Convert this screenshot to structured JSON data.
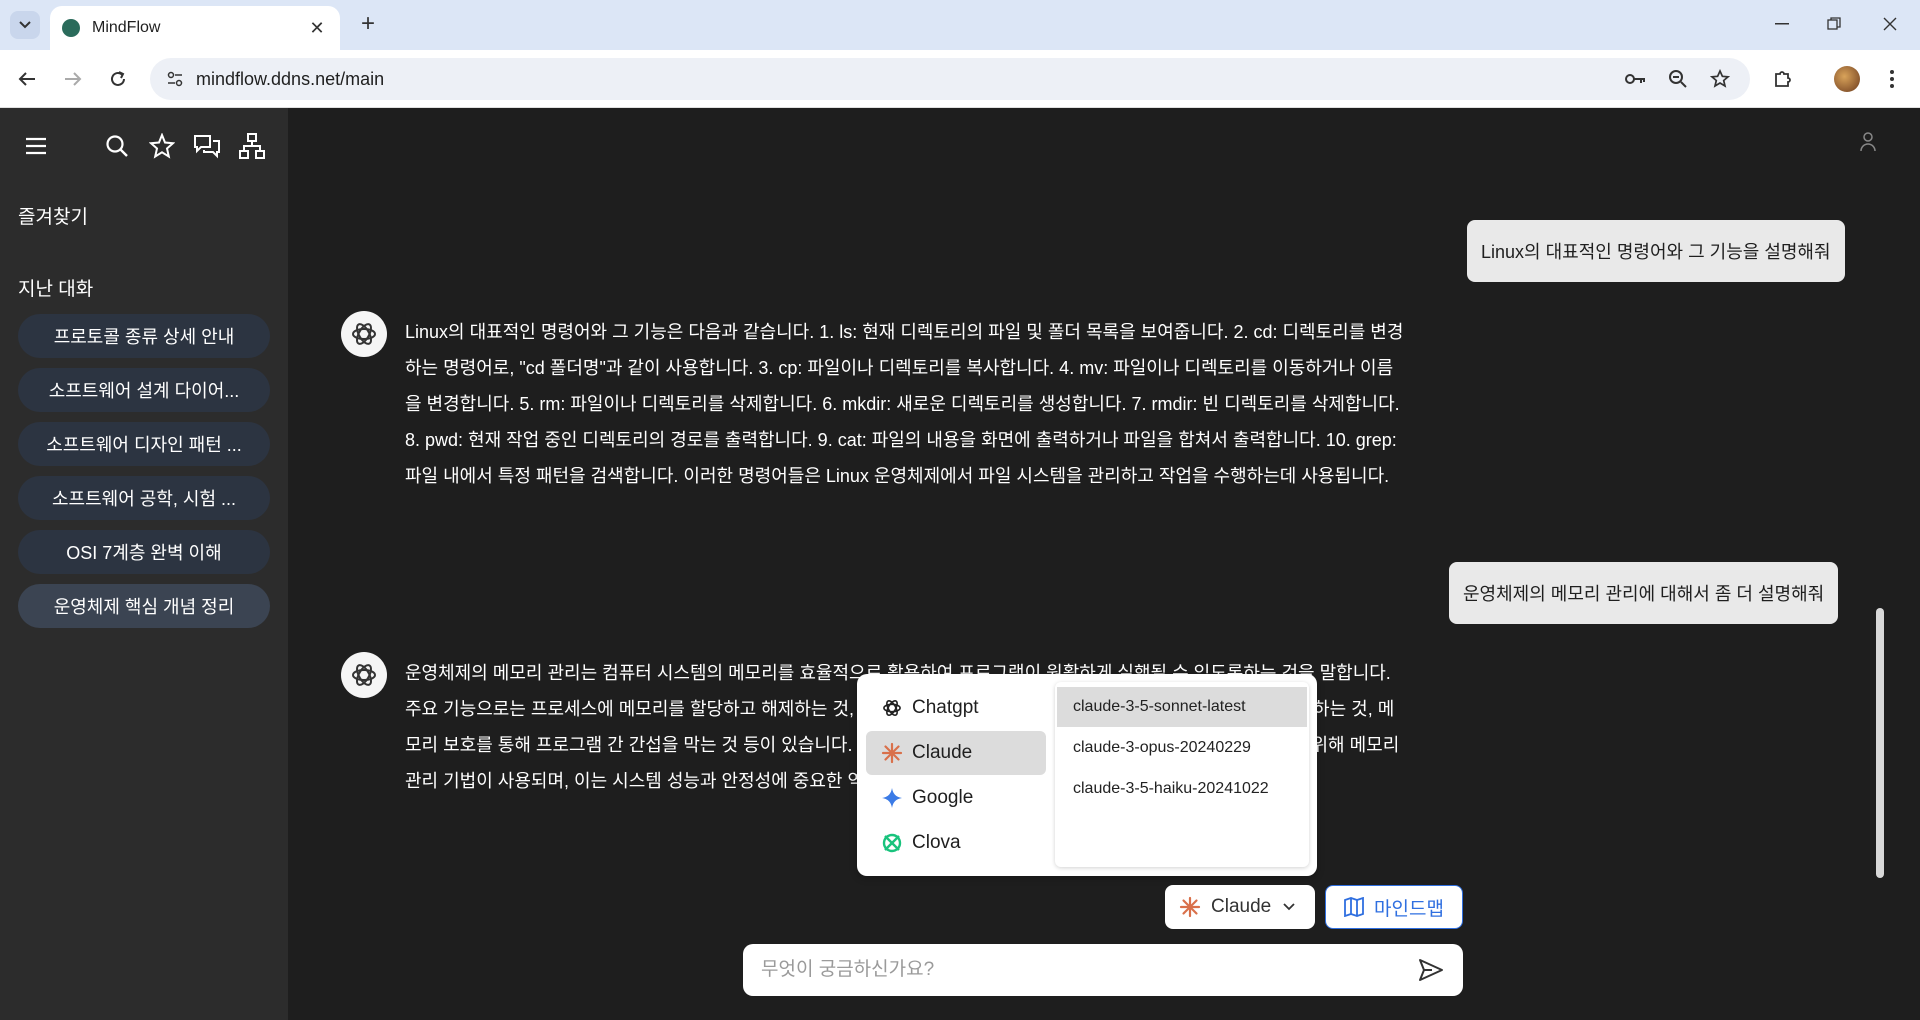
{
  "browser": {
    "tab_title": "MindFlow",
    "url": "mindflow.ddns.net/main"
  },
  "sidebar": {
    "favorites_heading": "즐겨찾기",
    "history_heading": "지난 대화",
    "history": [
      {
        "label": "프로토콜 종류 상세 안내"
      },
      {
        "label": "소프트웨어 설계 다이어..."
      },
      {
        "label": "소프트웨어 디자인 패턴 ..."
      },
      {
        "label": "소프트웨어 공학, 시험 ..."
      },
      {
        "label": "OSI 7계층 완벽 이해"
      },
      {
        "label": "운영체제 핵심 개념 정리"
      }
    ]
  },
  "chat": {
    "messages": [
      {
        "role": "user",
        "text": "Linux의 대표적인 명령어와 그 기능을 설명해줘"
      },
      {
        "role": "assistant",
        "text": "Linux의 대표적인 명령어와 그 기능은 다음과 같습니다. 1. ls: 현재 디렉토리의 파일 및 폴더 목록을 보여줍니다. 2. cd: 디렉토리를 변경하는 명령어로, \"cd 폴더명\"과 같이 사용합니다. 3. cp: 파일이나 디렉토리를 복사합니다. 4. mv: 파일이나 디렉토리를 이동하거나 이름을 변경합니다. 5. rm: 파일이나 디렉토리를 삭제합니다. 6. mkdir: 새로운 디렉토리를 생성합니다. 7. rmdir: 빈 디렉토리를 삭제합니다. 8. pwd: 현재 작업 중인 디렉토리의 경로를 출력합니다. 9. cat: 파일의 내용을 화면에 출력하거나 파일을 합쳐서 출력합니다. 10. grep: 파일 내에서 특정 패턴을 검색합니다. 이러한 명령어들은 Linux 운영체제에서 파일 시스템을 관리하고 작업을 수행하는데 사용됩니다."
      },
      {
        "role": "user",
        "text": "운영체제의 메모리 관리에 대해서 좀 더 설명해줘"
      },
      {
        "role": "assistant",
        "text": "운영체제의 메모리 관리는 컴퓨터 시스템의 메모리를 효율적으로 활용하여 프로그램이 원활하게 실행될 수 있도록하는 것을 말합니다. 주요 기능으로는 프로세스에 메모리를 할당하고 해제하는 것, 가상 메모리를 통해 물리 메모리 부족 시 보조기억장치를 사용하는 것, 메모리 보호를 통해 프로그램 간 간섭을 막는 것 등이 있습니다. 메모리 단편화를 최소화하고 효율적인 메모리 할당 및 해제를 위해 메모리 관리 기법이 사용되며, 이는 시스템 성능과 안정성에 중요한 역할을 합니다."
      }
    ]
  },
  "model_picker": {
    "providers": [
      {
        "label": "Chatgpt",
        "icon": "openai-icon"
      },
      {
        "label": "Claude",
        "icon": "claude-icon",
        "selected": true
      },
      {
        "label": "Google",
        "icon": "gemini-icon"
      },
      {
        "label": "Clova",
        "icon": "clova-icon"
      }
    ],
    "models": [
      {
        "label": "claude-3-5-sonnet-latest",
        "selected": true
      },
      {
        "label": "claude-3-opus-20240229"
      },
      {
        "label": "claude-3-5-haiku-20241022"
      }
    ]
  },
  "toolbar": {
    "model_button_label": "Claude",
    "mindmap_label": "마인드맵"
  },
  "input": {
    "placeholder": "무엇이 궁금하신가요?",
    "value": ""
  },
  "colors": {
    "accent_blue": "#2f6fe0",
    "claude_orange": "#d9704a",
    "sidebar_bg": "#2c2c2c",
    "main_bg": "#1e1e1e"
  }
}
